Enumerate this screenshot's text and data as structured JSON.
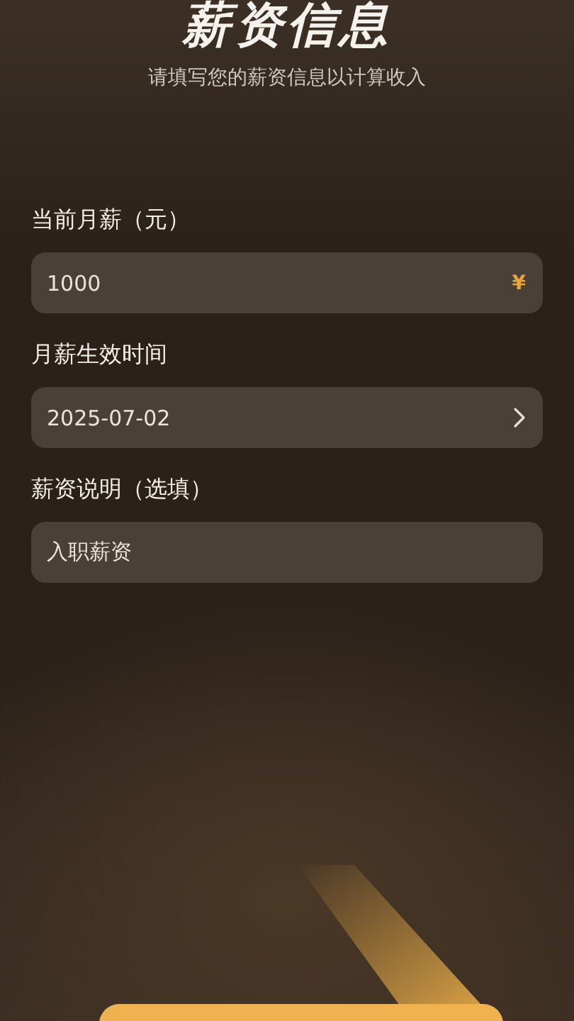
{
  "header": {
    "title": "薪资信息",
    "subtitle": "请填写您的薪资信息以计算收入"
  },
  "fields": [
    {
      "kind": "amount",
      "label": "当前月薪（元）",
      "value": "1000",
      "suffix": "¥"
    },
    {
      "kind": "picker",
      "label": "月薪生效时间",
      "value": "2025-07-02"
    },
    {
      "kind": "text",
      "label": "薪资说明（选填）",
      "value": "入职薪资"
    }
  ]
}
